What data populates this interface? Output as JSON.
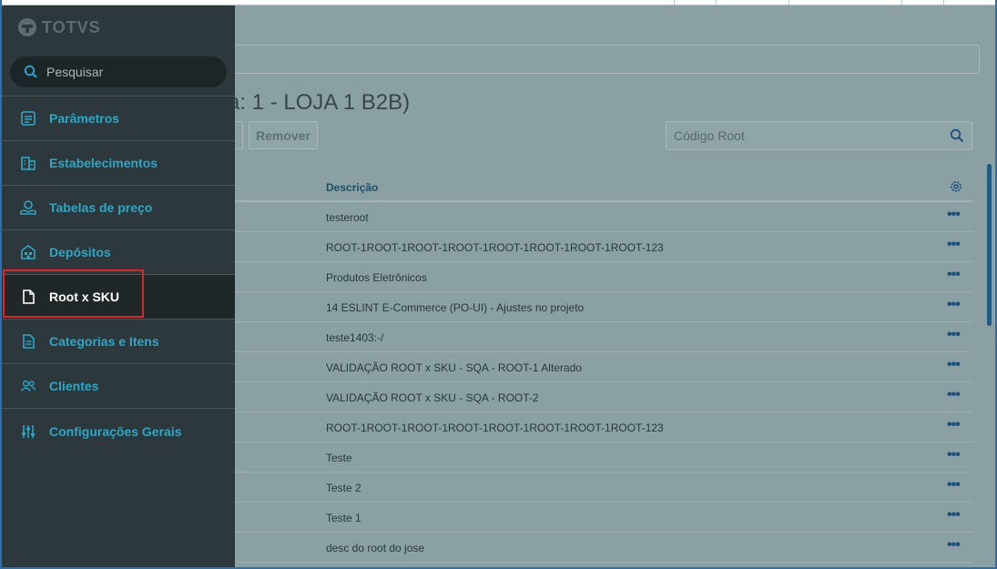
{
  "app": {
    "logo_text": "TOTVS"
  },
  "sidebar": {
    "search_placeholder": "Pesquisar",
    "items": [
      {
        "label": "Parâmetros",
        "icon": "parameters-icon"
      },
      {
        "label": "Estabelecimentos",
        "icon": "building-icon"
      },
      {
        "label": "Tabelas de preço",
        "icon": "price-table-icon"
      },
      {
        "label": "Depósitos",
        "icon": "warehouse-icon"
      },
      {
        "label": "Root x SKU",
        "icon": "document-icon",
        "active": true
      },
      {
        "label": "Categorias e Itens",
        "icon": "list-document-icon"
      },
      {
        "label": "Clientes",
        "icon": "users-icon"
      },
      {
        "label": "Configurações Gerais",
        "icon": "sliders-icon"
      }
    ]
  },
  "main": {
    "title": "a: 1 - LOJA 1 B2B)",
    "remove_label": "Remover",
    "search_placeholder": "Código Root",
    "table": {
      "column_desc": "Descrição",
      "rows": [
        "testeroot",
        "ROOT-1ROOT-1ROOT-1ROOT-1ROOT-1ROOT-1ROOT-1ROOT-123",
        "Produtos Eletrônicos",
        "14 ESLINT E-Commerce (PO-UI) - Ajustes no projeto",
        "teste1403:-/",
        "VALIDAÇÃO ROOT x SKU - SQA - ROOT-1 Alterado",
        "VALIDAÇÃO ROOT x SKU - SQA - ROOT-2",
        "ROOT-1ROOT-1ROOT-1ROOT-1ROOT-1ROOT-1ROOT-1ROOT-123",
        "Teste",
        "Teste 2",
        "Teste 1",
        "desc do root do jose"
      ],
      "row_action_label": "•••"
    }
  },
  "colors": {
    "accent": "#2ca7c7",
    "sidebar_bg": "#2c383b",
    "highlight": "#e02424"
  }
}
